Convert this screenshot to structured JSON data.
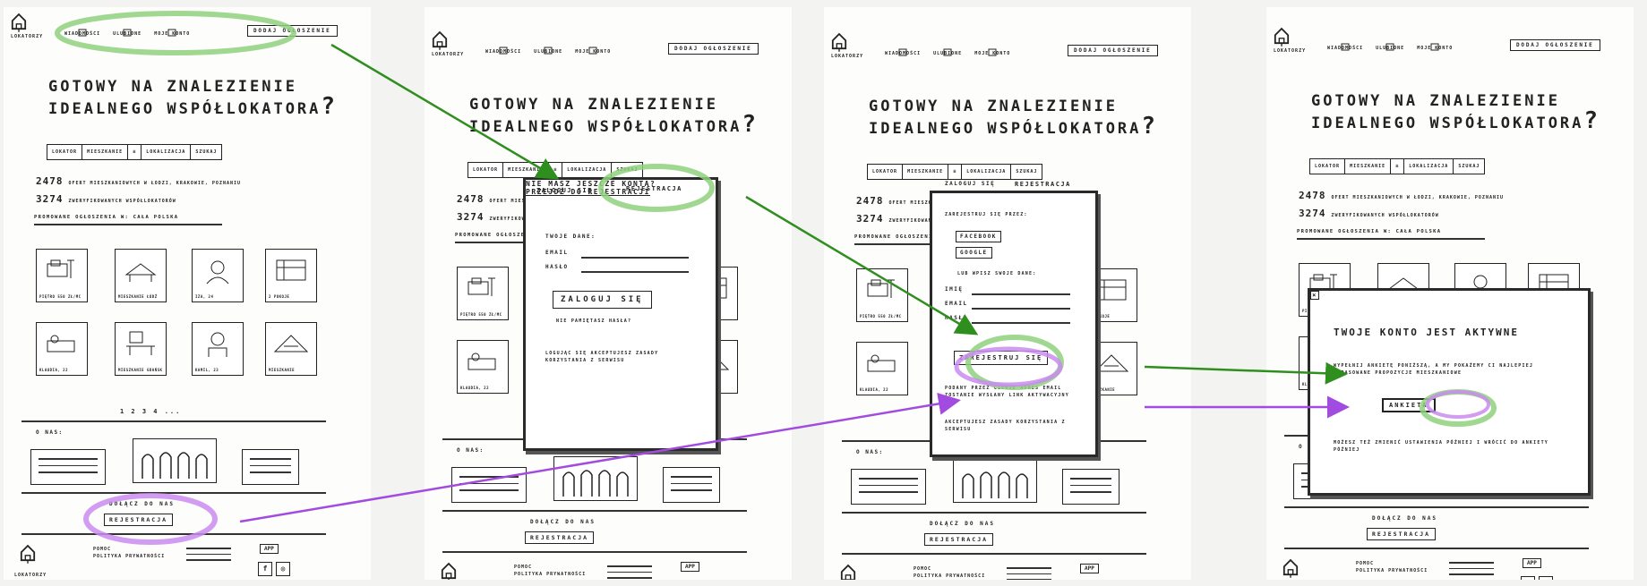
{
  "screens": [
    {
      "id": "home",
      "brand": "LOKATORZY",
      "nav": [
        "WIADOMOŚCI",
        "ULUBIONE",
        "MOJE KONTO"
      ],
      "add_button": "DODAJ OGŁOSZENIE",
      "hero_line1": "GOTOWY NA ZNALEZIENIE",
      "hero_line2": "IDEALNEGO WSPÓŁLOKATORA",
      "hero_q": "?",
      "search": [
        "LOKATOR",
        "MIESZKANIE",
        "LOKALIZACJA",
        "SZUKAJ"
      ],
      "stat1_num": "2478",
      "stat1_text": "OFERT MIESZKANIOWYCH W ŁODZI, KRAKOWIE, POZNANIU",
      "stat2_num": "3274",
      "stat2_text": "ZWERYFIKOWANYCH WSPÓŁLOKATORÓW",
      "promo": "PROMOWANE OGŁOSZENIA W: CAŁA POLSKA",
      "tiles": [
        "PIĘTRO 550 ZŁ/MC",
        "MIESZKANIE ŁÓDŹ",
        "IZA, 24",
        "2 POKOJE",
        "KLAUDIA, 22",
        "MIESZKANIE GDAŃSK",
        "KAMIL, 23",
        "MIESZKANIE"
      ],
      "pager": "1 2 3 4 ...",
      "about": "O NAS:",
      "join": "DOŁĄCZ DO NAS",
      "register": "REJESTRACJA",
      "footer_links": [
        "POMOC",
        "POLITYKA PRYWATNOŚCI"
      ],
      "app": "APP",
      "social": [
        "f",
        "◎"
      ]
    }
  ],
  "login_modal": {
    "tab_login": "ZALOGUJ SIĘ",
    "tab_register": "REJESTRACJA",
    "data_label": "TWOJE DANE:",
    "email": "EMAIL",
    "password": "HASŁO",
    "login_button": "ZALOGUJ SIĘ",
    "forgot": "NIE PAMIĘTASZ HASŁA?",
    "terms": "LOGUJĄC SIĘ AKCEPTUJESZ ZASADY KORZYSTANIA Z SERWISU",
    "no_account": "NIE MASZ JESZCZE KONTA?",
    "go_register": "PRZEJDŹ DO REJESTRACJI"
  },
  "register_modal": {
    "tab_login": "ZALOGUJ SIĘ",
    "tab_register": "REJESTRACJA",
    "via": "ZAREJESTRUJ SIĘ PRZEZ:",
    "facebook": "FACEBOOK",
    "google": "GOOGLE",
    "or": "LUB WPISZ SWOJE DANE:",
    "name": "IMIĘ",
    "email": "EMAIL",
    "password": "HASŁO",
    "register_button": "ZAREJESTRUJ SIĘ",
    "mail_note": "PODANY PRZEZ CIEBIE ADRES EMAIL ZOSTANIE WYSŁANY LINK AKTYWACYJNY",
    "terms": "AKCEPTUJESZ ZASADY KORZYSTANIA Z SERWISU"
  },
  "active_modal": {
    "close": "×",
    "title": "TWOJE KONTO JEST AKTYWNE",
    "body": "WYPEŁNIJ ANKIETĘ PONIŻSZĄ, A MY POKAŻEMY CI NAJLEPIEJ DOPASOWANE PROPOZYCJE MIESZKANIOWE",
    "survey_button": "ANKIETA",
    "footnote": "MOŻESZ TEŻ ZMIENIĆ USTAWIENIA PÓŹNIEJ I WRÓCIĆ DO ANKIETY PÓŹNIEJ"
  },
  "colors": {
    "green": "#2f8f1e",
    "purple": "#a24be0",
    "green_highlight": "#86c77a",
    "purple_highlight": "#c98bf0"
  }
}
